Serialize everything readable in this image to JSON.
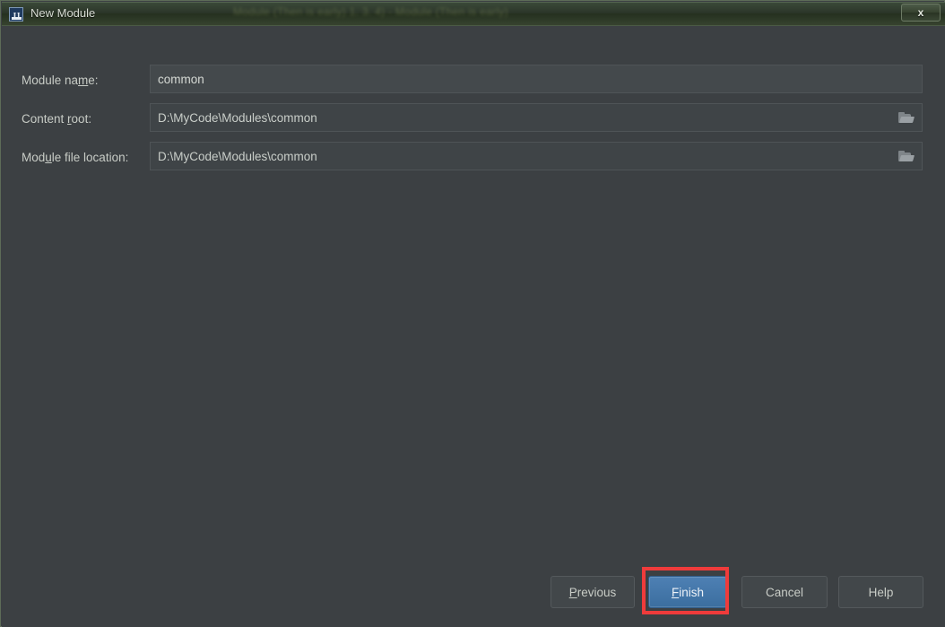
{
  "window": {
    "title": "New Module",
    "app_icon": "intellij-idea-icon",
    "background_window_title_ghost": "Module (Then is early) 1. 3. 4) - Module (Then is early)",
    "close_label": "x",
    "frame_color": "#5d6b58",
    "body_color": "#3c4043",
    "titlebar_color": "#2b3529"
  },
  "form": {
    "rows": [
      {
        "label_before": "Module na",
        "label_mnemonic": "m",
        "label_after": "e:",
        "value": "common",
        "has_browse": false,
        "browse_icon": "folder-open-icon"
      },
      {
        "label_before": "Content ",
        "label_mnemonic": "r",
        "label_after": "oot:",
        "value": "D:\\MyCode\\Modules\\common",
        "has_browse": true,
        "browse_icon": "folder-open-icon"
      },
      {
        "label_before": "Mod",
        "label_mnemonic": "u",
        "label_after": "le file location:",
        "value": "D:\\MyCode\\Modules\\common",
        "has_browse": true,
        "browse_icon": "folder-open-icon"
      }
    ]
  },
  "footer": {
    "buttons": [
      {
        "before": "",
        "mnemonic": "P",
        "after": "revious",
        "primary": false
      },
      {
        "before": "",
        "mnemonic": "F",
        "after": "inish",
        "primary": true
      },
      {
        "before": "Cancel",
        "mnemonic": "",
        "after": "",
        "primary": false
      },
      {
        "before": "Help",
        "mnemonic": "",
        "after": "",
        "primary": false
      }
    ]
  },
  "annotation": {
    "highlight_color": "#ef3b3b",
    "target": "Finish"
  }
}
